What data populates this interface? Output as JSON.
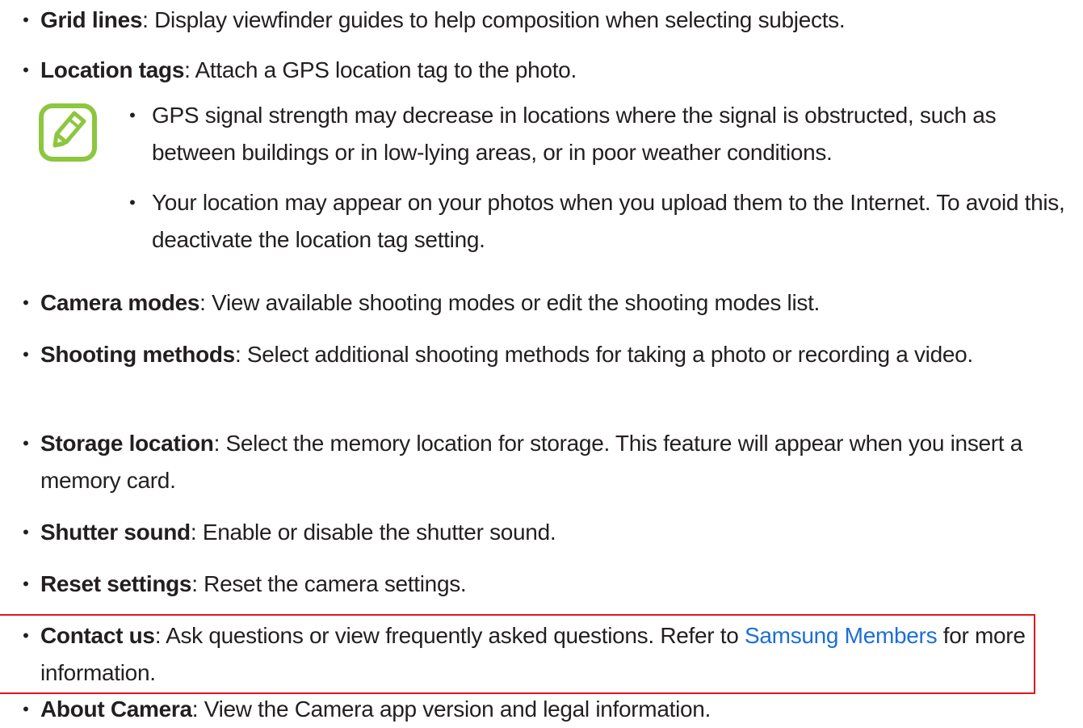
{
  "items_top": [
    {
      "term": "Grid lines",
      "desc": ": Display viewfinder guides to help composition when selecting subjects."
    },
    {
      "term": "Location tags",
      "desc": ": Attach a GPS location tag to the photo."
    }
  ],
  "note": {
    "icon": "note-pencil-icon",
    "icon_color": "#8dc63f",
    "bullets": [
      "GPS signal strength may decrease in locations where the signal is obstructed, such as between buildings or in low-lying areas, or in poor weather conditions.",
      "Your location may appear on your photos when you upload them to the Internet. To avoid this, deactivate the location tag setting."
    ]
  },
  "items_bottom": [
    {
      "term": "Camera modes",
      "desc": ": View available shooting modes or edit the shooting modes list."
    },
    {
      "term": "Shooting methods",
      "desc": ": Select additional shooting methods for taking a photo or recording a video."
    },
    {
      "term": "Storage location",
      "desc": ": Select the memory location for storage. This feature will appear when you insert a memory card."
    },
    {
      "term": "Shutter sound",
      "desc": ": Enable or disable the shutter sound."
    },
    {
      "term": "Reset settings",
      "desc": ": Reset the camera settings."
    }
  ],
  "contact": {
    "term": "Contact us",
    "desc_before": ": Ask questions or view frequently asked questions. Refer to ",
    "link": "Samsung Members",
    "desc_after": " for more information."
  },
  "about": {
    "term": "About Camera",
    "desc": ": View the Camera app version and legal information."
  },
  "bullet_char": "•",
  "colors": {
    "text": "#231f20",
    "link": "#1b6fd6",
    "highlight": "#e3161b"
  }
}
